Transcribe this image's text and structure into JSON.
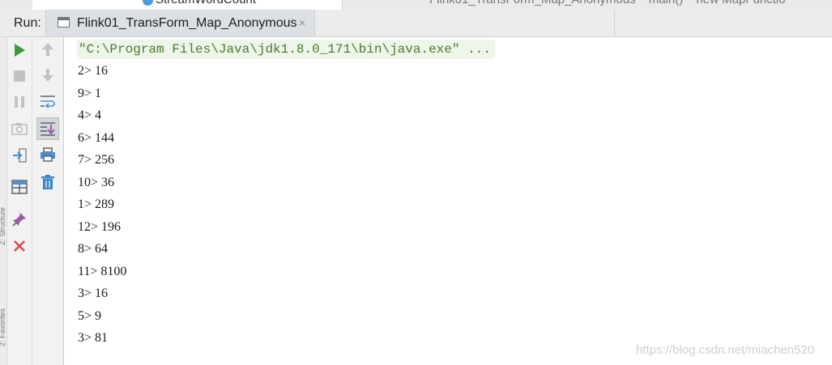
{
  "top_bar": {
    "project_item": "StreamWordCount",
    "breadcrumbs": [
      "Flink01_TransForm_Map_Anonymous",
      "main()",
      "new MapFunctio"
    ]
  },
  "run_bar": {
    "label": "Run:",
    "tab_title": "Flink01_TransForm_Map_Anonymous",
    "close_glyph": "×"
  },
  "side_gutter": {
    "labels": [
      "Z: Structure",
      "2: Favorites"
    ]
  },
  "toolbar_left": [
    {
      "icon": "run-icon",
      "color": "#3e9b3e"
    },
    {
      "icon": "stop-icon",
      "color": "#b8b8b8"
    },
    {
      "icon": "pause-icon",
      "color": "#b8b8b8"
    },
    {
      "icon": "camera-icon",
      "color": "#b8b8b8"
    },
    {
      "icon": "login-icon",
      "color": "#8a9099"
    },
    {
      "icon": "layout-icon",
      "color": "#5a6470"
    },
    {
      "icon": "pin-icon",
      "color": "#9a5aa8"
    },
    {
      "icon": "close-icon",
      "color": "#d94b4b"
    }
  ],
  "toolbar_right": [
    {
      "icon": "up-arrow-icon",
      "color": "#b8b8b8"
    },
    {
      "icon": "down-arrow-icon",
      "color": "#b8b8b8"
    },
    {
      "icon": "soft-wrap-icon",
      "color": "#4a8fd1"
    },
    {
      "icon": "scroll-to-end-icon",
      "color": "#5a6470"
    },
    {
      "icon": "print-icon",
      "color": "#4a8fd1"
    },
    {
      "icon": "trash-icon",
      "color": "#3a85c9"
    }
  ],
  "console": {
    "command": "\"C:\\Program Files\\Java\\jdk1.8.0_171\\bin\\java.exe\" ...",
    "lines": [
      "2> 16",
      "9> 1",
      "4> 4",
      "6> 144",
      "7> 256",
      "10> 36",
      "1> 289",
      "12> 196",
      "8> 64",
      "11> 8100",
      "3> 16",
      "5> 9",
      "3> 81"
    ]
  },
  "watermark": "https://blog.csdn.net/miachen520"
}
